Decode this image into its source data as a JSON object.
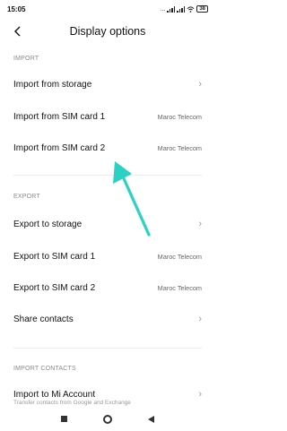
{
  "status": {
    "time": "15:05",
    "dots": "...",
    "battery": "38"
  },
  "header": {
    "title": "Display options"
  },
  "sections": [
    {
      "label": "IMPORT"
    },
    {
      "label": "EXPORT"
    },
    {
      "label": "IMPORT CONTACTS"
    }
  ],
  "rows": {
    "import_storage": {
      "label": "Import from storage"
    },
    "import_sim1": {
      "label": "Import from SIM card 1",
      "value": "Maroc Telecom"
    },
    "import_sim2": {
      "label": "Import from SIM card 2",
      "value": "Maroc Telecom"
    },
    "export_storage": {
      "label": "Export to storage"
    },
    "export_sim1": {
      "label": "Export to SIM card 1",
      "value": "Maroc Telecom"
    },
    "export_sim2": {
      "label": "Export to SIM card 2",
      "value": "Maroc Telecom"
    },
    "share": {
      "label": "Share contacts"
    },
    "mi_account": {
      "label": "Import to Mi Account",
      "subtitle": "Transfer contacts from Google and Exchange"
    }
  },
  "colors": {
    "annotation_arrow": "#2ad1c4"
  },
  "icons": {
    "back": "back-arrow-icon",
    "chevron": "chevron-right-icon",
    "nav_recent": "square-icon",
    "nav_home": "circle-icon",
    "nav_back": "triangle-icon"
  }
}
